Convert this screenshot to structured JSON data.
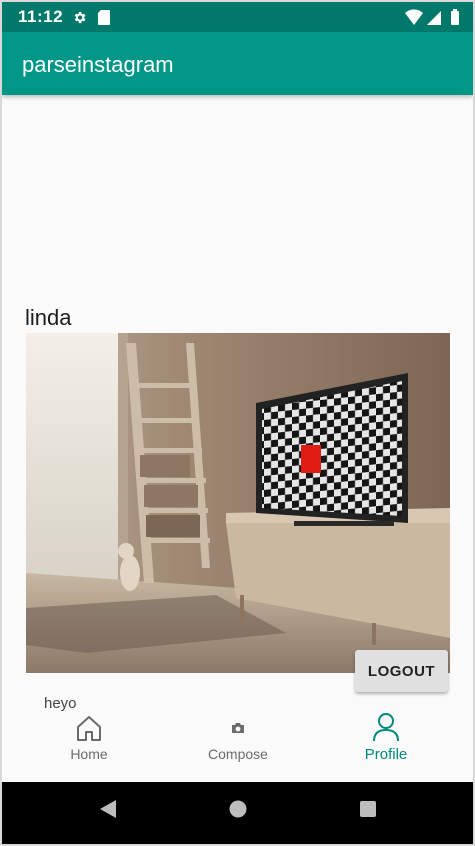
{
  "status_bar": {
    "time": "11:12"
  },
  "app_bar": {
    "title": "parseinstagram"
  },
  "profile": {
    "username": "linda",
    "caption": "heyo"
  },
  "buttons": {
    "logout": "LOGOUT"
  },
  "bottom_nav": {
    "items": [
      {
        "label": "Home",
        "icon": "home-icon",
        "active": false
      },
      {
        "label": "Compose",
        "icon": "camera-icon",
        "active": false
      },
      {
        "label": "Profile",
        "icon": "person-icon",
        "active": true
      }
    ]
  },
  "system_nav": {
    "back": "back-icon",
    "home": "home-circle-icon",
    "recents": "recents-icon"
  },
  "colors": {
    "primary": "#009688",
    "primary_dark": "#00796b",
    "accent": "#00897b"
  }
}
